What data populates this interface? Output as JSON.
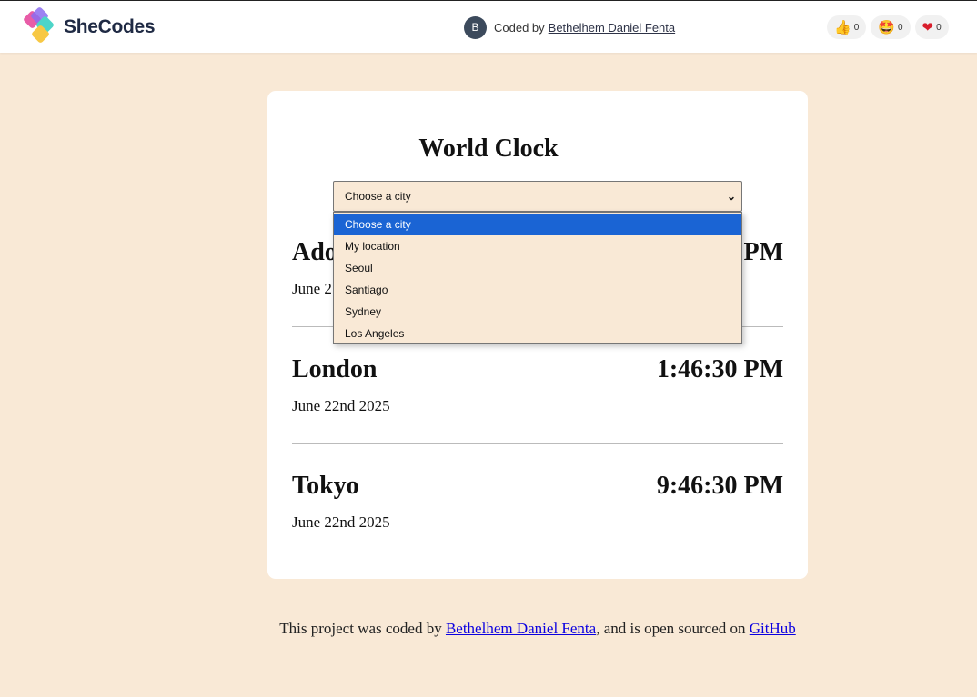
{
  "header": {
    "brand": "SheCodes",
    "avatar_initial": "B",
    "coded_by_text": "Coded by",
    "author": "Bethelhem Daniel Fenta",
    "reactions": [
      {
        "icon": "thumbs-up-icon",
        "glyph": "👍",
        "count": "0"
      },
      {
        "icon": "star-eyes-icon",
        "glyph": "🤩",
        "count": "0"
      },
      {
        "icon": "heart-icon",
        "glyph": "❤",
        "count": "0"
      }
    ]
  },
  "app": {
    "title": "World Clock",
    "select": {
      "selected": "Choose a city",
      "options": [
        "Choose a city",
        "My location",
        "Seoul",
        "Santiago",
        "Sydney",
        "Los Angeles"
      ],
      "highlighted_index": 0
    },
    "cities": [
      {
        "name": "Ado",
        "time": "PM",
        "date": "June 2"
      },
      {
        "name": "London",
        "time": "1:46:30 PM",
        "date": "June 22nd 2025"
      },
      {
        "name": "Tokyo",
        "time": "9:46:30 PM",
        "date": "June 22nd 2025"
      }
    ]
  },
  "footer": {
    "text_1": "This project was coded by ",
    "author_link": "Bethelhem Daniel Fenta",
    "text_2": ", and is open sourced on ",
    "github_link": "GitHub"
  },
  "colors": {
    "page_background": "#f9e9d6",
    "highlight": "#1a64d4",
    "link": "#0b00e0"
  }
}
